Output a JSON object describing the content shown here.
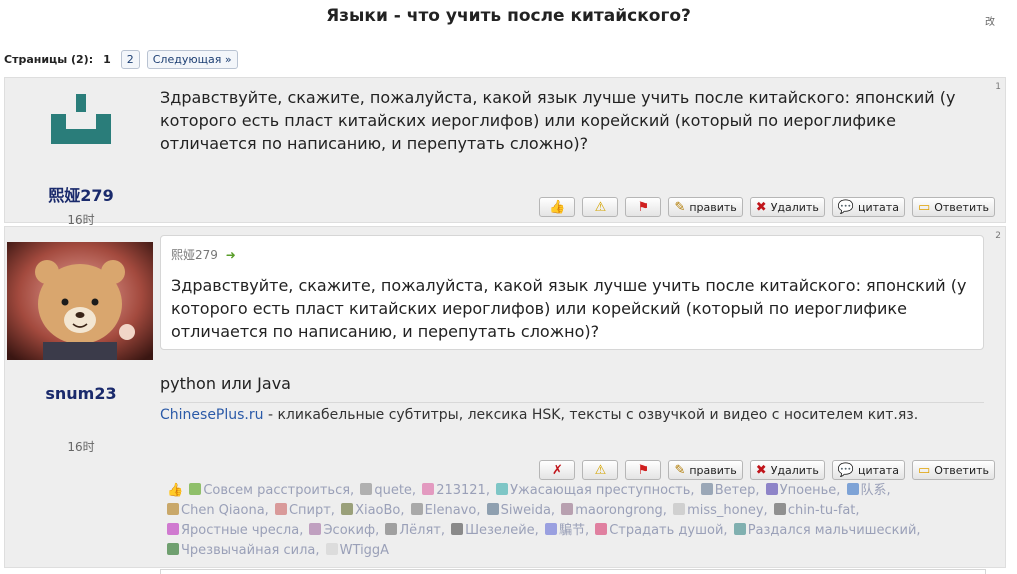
{
  "page": {
    "title": "Языки - что учить после китайского?",
    "lang_toggle": "改"
  },
  "pager": {
    "label": "Страницы (2):",
    "pages": [
      "1",
      "2"
    ],
    "next": "Следующая »"
  },
  "post1": {
    "number": "1",
    "author": "熙娅279",
    "time": "16时",
    "text": "Здравствуйте, скажите, пожалуйста, какой язык лучше учить после китайского: японский (у которого есть пласт китайских иероглифов) или корейский (который по иероглифике отличается по написанию, и перепутать сложно)?"
  },
  "post2": {
    "number": "2",
    "author": "snum23",
    "time": "16时",
    "quote_author": "熙娅279",
    "quote_text": "Здравствуйте, скажите, пожалуйста, какой язык лучше учить после китайского: японский (у которого есть пласт китайских иероглифов) или корейский (который по иероглифике отличается по написанию, и перепутать сложно)?",
    "text": "python или Java",
    "signature_link": "ChinesePlus.ru",
    "signature_text": " - кликабельные субтитры, лексика HSK, тексты с озвучкой и видео с носителем кит.яз."
  },
  "toolbar": {
    "edit": "править",
    "delete": "Удалить",
    "quote": "цитата",
    "reply": "Ответить"
  },
  "reactions": [
    "Совсем расстроиться,",
    "quete,",
    "213121,",
    "Ужасающая преступность,",
    "Ветер,",
    "Упоенье,",
    "队系,",
    "Chen Qiaona,",
    "Спирт,",
    "XiaoBo,",
    "Elenavo,",
    "Siweida,",
    "maorongrong,",
    "miss_honey,",
    "chin-tu-fat,",
    "Яростные чресла,",
    "Эсокиф,",
    "Лёлят,",
    "Шезелейе,",
    "騙节,",
    "Страдать душой,",
    "Раздался мальчишеский,",
    "Чрезвычайная сила,",
    "WTiggA"
  ],
  "colors": {
    "author_name": "#1a2a6c",
    "link": "#2b5aa8",
    "post_bg": "#eeeeee",
    "avatar1": "#2a7d7a"
  }
}
